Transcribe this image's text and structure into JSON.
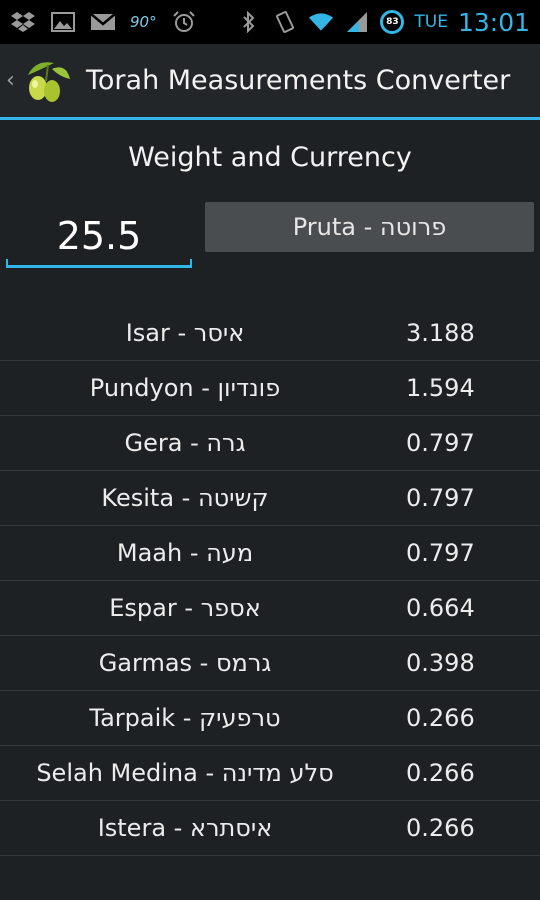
{
  "status_bar": {
    "temperature": "90°",
    "battery": "83",
    "day": "TUE",
    "time": "13:01",
    "icons": [
      "dropbox-icon",
      "image-icon",
      "gmail-icon",
      "weather-icon",
      "alarm-icon",
      "bluetooth-icon",
      "vibrate-icon",
      "wifi-icon",
      "signal-icon",
      "battery-icon"
    ]
  },
  "action_bar": {
    "title": "Torah Measurements Converter",
    "logo": "olive-branch-logo"
  },
  "converter": {
    "category": "Weight and Currency",
    "amount": "25.5",
    "selected_unit": "Pruta - פרוטה"
  },
  "results": [
    {
      "name": "Isar - איסר",
      "value": "3.188"
    },
    {
      "name": "Pundyon - פונדיון",
      "value": "1.594"
    },
    {
      "name": "Gera - גרה",
      "value": "0.797"
    },
    {
      "name": "Kesita - קשיטה",
      "value": "0.797"
    },
    {
      "name": "Maah - מעה",
      "value": "0.797"
    },
    {
      "name": "Espar - אספר",
      "value": "0.664"
    },
    {
      "name": "Garmas - גרמס",
      "value": "0.398"
    },
    {
      "name": "Tarpaik - טרפעיק",
      "value": "0.266"
    },
    {
      "name": "Selah Medina - סלע מדינה",
      "value": "0.266"
    },
    {
      "name": "Istera - איסתרא",
      "value": "0.266"
    }
  ],
  "colors": {
    "accent": "#33b5e5",
    "background": "#1e2124",
    "spinner": "#4a4d50"
  }
}
